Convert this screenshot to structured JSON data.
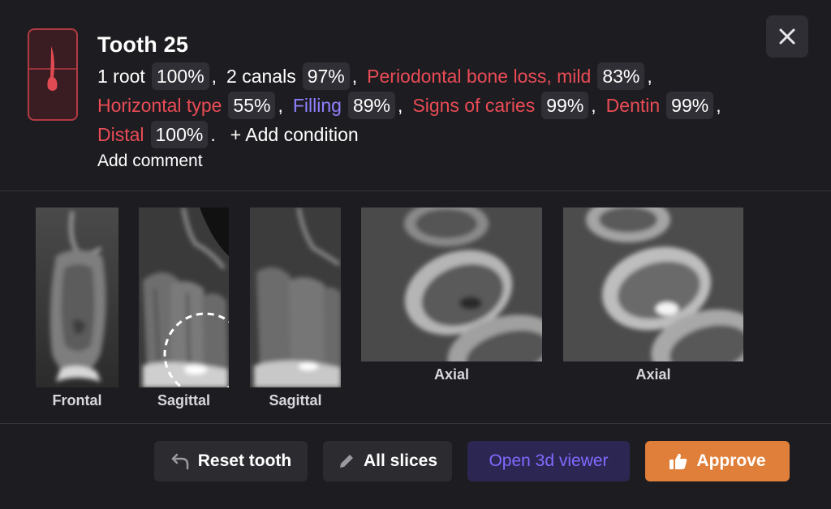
{
  "header": {
    "title": "Tooth 25",
    "close_icon": "close-icon",
    "tooth_icon": "tooth-root-icon",
    "accent_red": "#ea4b55",
    "accent_purple": "#8f80ff"
  },
  "conditions": {
    "line1": [
      {
        "name": "1 root",
        "pct": "100%",
        "color": "white",
        "sep": ","
      },
      {
        "name": "2 canals",
        "pct": "97%",
        "color": "white",
        "sep": ","
      },
      {
        "name": "Periodontal bone loss, mild",
        "pct": "83%",
        "color": "red",
        "sep": ","
      }
    ],
    "line2": [
      {
        "name": "Horizontal type",
        "pct": "55%",
        "color": "red",
        "sep": ","
      },
      {
        "name": "Filling",
        "pct": "89%",
        "color": "purple",
        "sep": ","
      },
      {
        "name": "Signs of caries",
        "pct": "99%",
        "color": "red",
        "sep": ","
      },
      {
        "name": "Dentin",
        "pct": "99%",
        "color": "red",
        "sep": ","
      }
    ],
    "line3": [
      {
        "name": "Distal",
        "pct": "100%",
        "color": "red",
        "sep": "."
      }
    ],
    "add_condition": "+ Add condition",
    "add_comment": "Add comment"
  },
  "slices": [
    {
      "label": "Frontal"
    },
    {
      "label": "Sagittal"
    },
    {
      "label": "Sagittal"
    },
    {
      "label": "Axial"
    },
    {
      "label": "Axial"
    }
  ],
  "footer": {
    "reset_label": "Reset tooth",
    "reset_icon": "undo-icon",
    "slices_label": "All slices",
    "slices_icon": "pencil-icon",
    "viewer_label": "Open 3d viewer",
    "approve_label": "Approve",
    "approve_icon": "thumbs-up-icon",
    "approve_color": "#e07f39"
  }
}
